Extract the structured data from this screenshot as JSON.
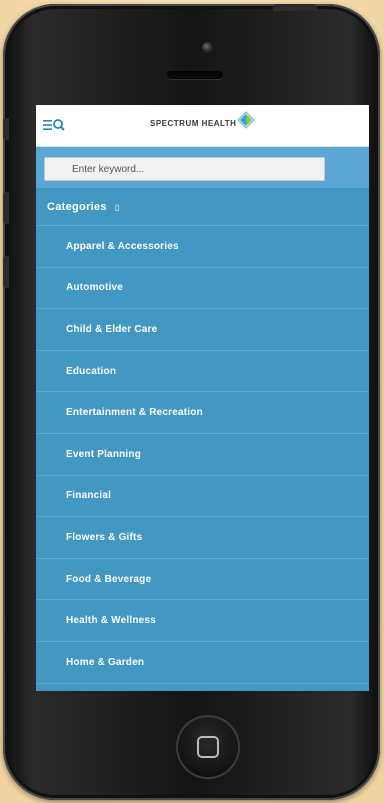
{
  "header": {
    "logo_text": "SPECTRUM HEALTH"
  },
  "search": {
    "placeholder": "Enter keyword..."
  },
  "categories": {
    "title": "Categories",
    "caret": "▯",
    "items": [
      {
        "label": "Apparel & Accessories"
      },
      {
        "label": "Automotive"
      },
      {
        "label": "Child & Elder Care"
      },
      {
        "label": "Education"
      },
      {
        "label": "Entertainment & Recreation"
      },
      {
        "label": "Event Planning"
      },
      {
        "label": "Financial"
      },
      {
        "label": "Flowers & Gifts"
      },
      {
        "label": "Food & Beverage"
      },
      {
        "label": "Health & Wellness"
      },
      {
        "label": "Home & Garden"
      }
    ]
  },
  "colors": {
    "panel": "#4398c3",
    "searchbar": "#5aa6d4",
    "logo_accent": "#8ac43f"
  },
  "icons": [
    "menu-search-icon",
    "spectrum-logo-icon",
    "camera-icon",
    "home-button-icon"
  ]
}
